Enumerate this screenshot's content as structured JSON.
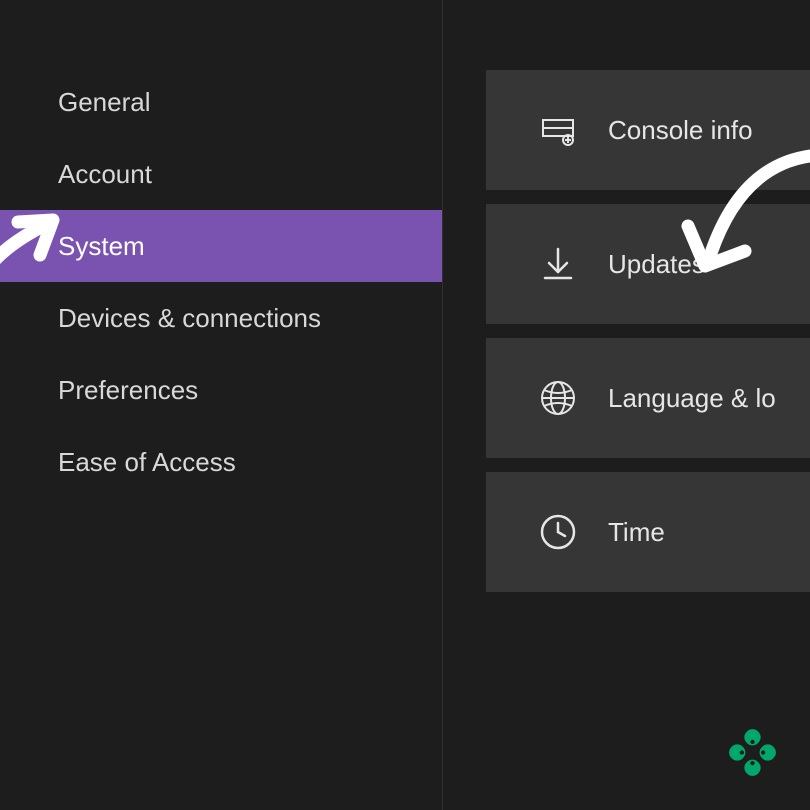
{
  "sidebar": {
    "items": [
      {
        "label": "General",
        "selected": false
      },
      {
        "label": "Account",
        "selected": false
      },
      {
        "label": "System",
        "selected": true
      },
      {
        "label": "Devices & connections",
        "selected": false
      },
      {
        "label": "Preferences",
        "selected": false
      },
      {
        "label": "Ease of Access",
        "selected": false
      }
    ]
  },
  "tiles": [
    {
      "icon": "console-info-icon",
      "label": "Console info"
    },
    {
      "icon": "download-icon",
      "label": "Updates"
    },
    {
      "icon": "globe-icon",
      "label": "Language & lo"
    },
    {
      "icon": "clock-icon",
      "label": "Time"
    }
  ],
  "colors": {
    "accent": "#7a53b0",
    "annotation": "#ffffff",
    "logo": "#00a86b"
  }
}
